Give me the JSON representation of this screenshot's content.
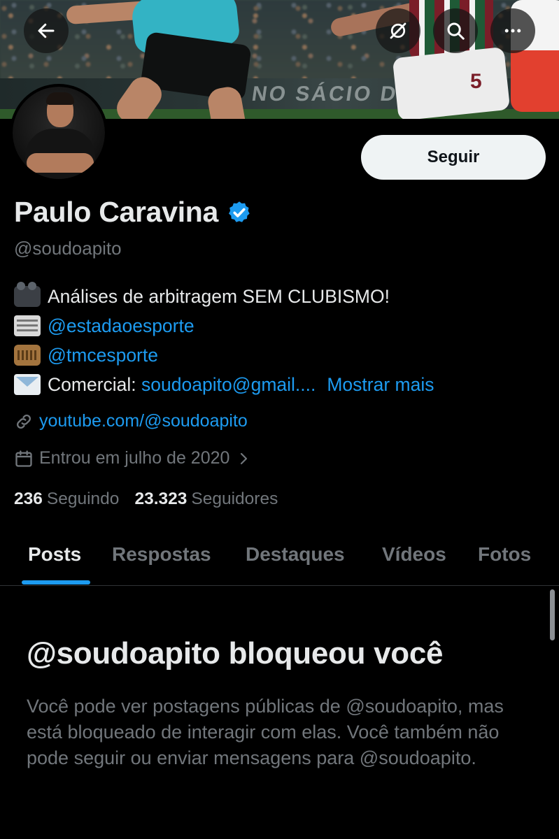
{
  "header": {
    "back_icon": "arrow-left-icon",
    "grok_icon": "grok-icon",
    "search_icon": "search-icon",
    "more_icon": "more-horizontal-icon",
    "banner_text": "NO SÁCIO DO PAPA"
  },
  "profile": {
    "follow_label": "Seguir",
    "name": "Paulo Caravina",
    "handle": "@soudoapito",
    "verified_color": "#1d9bf0",
    "bio": {
      "line1_text": "Análises de arbitragem SEM CLUBISMO!",
      "line2_mention": "@estadaoesporte",
      "line3_mention": "@tmcesporte",
      "line4_prefix": "Comercial: ",
      "line4_email": "soudoapito@gmail....",
      "show_more": "Mostrar mais"
    },
    "website": "youtube.com/@soudoapito",
    "joined": "Entrou em julho de 2020",
    "following_count": "236",
    "following_label": "Seguindo",
    "followers_count": "23.323",
    "followers_label": "Seguidores"
  },
  "tabs": [
    "Posts",
    "Respostas",
    "Destaques",
    "Vídeos",
    "Fotos"
  ],
  "blocked": {
    "title": "@soudoapito bloqueou você",
    "message": "Você pode ver postagens públicas de @soudoapito, mas está bloqueado de interagir com elas. Você também não pode seguir ou enviar mensagens para @soudoapito."
  },
  "colors": {
    "background": "#000000",
    "accent": "#1d9bf0",
    "text_primary": "#e7e9ea",
    "text_secondary": "#71767b"
  }
}
